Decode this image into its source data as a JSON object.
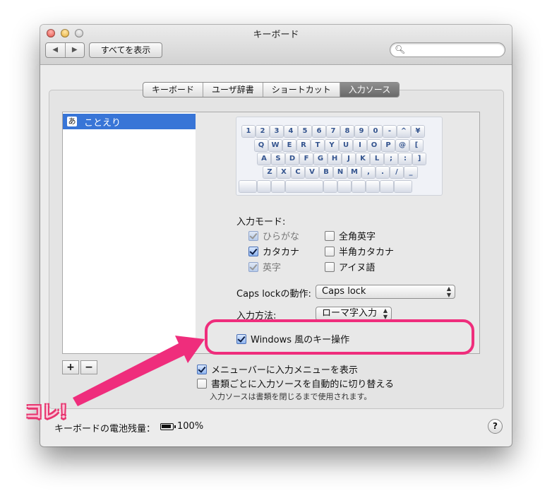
{
  "window": {
    "title": "キーボード",
    "nav_back": "◀",
    "nav_forward": "▶",
    "show_all": "すべてを表示",
    "search_placeholder": ""
  },
  "tabs": [
    {
      "label": "キーボード",
      "active": false
    },
    {
      "label": "ユーザ辞書",
      "active": false
    },
    {
      "label": "ショートカット",
      "active": false
    },
    {
      "label": "入力ソース",
      "active": true
    }
  ],
  "sources": [
    {
      "glyph": "あ",
      "label": "ことえり",
      "selected": true
    }
  ],
  "keyboard": {
    "rows": [
      [
        "1",
        "2",
        "3",
        "4",
        "5",
        "6",
        "7",
        "8",
        "9",
        "0",
        "-",
        "^",
        "¥"
      ],
      [
        "Q",
        "W",
        "E",
        "R",
        "T",
        "Y",
        "U",
        "I",
        "O",
        "P",
        "@",
        "["
      ],
      [
        "A",
        "S",
        "D",
        "F",
        "G",
        "H",
        "J",
        "K",
        "L",
        ";",
        ":",
        "]"
      ],
      [
        "Z",
        "X",
        "C",
        "V",
        "B",
        "N",
        "M",
        ",",
        ".",
        "/",
        "_"
      ]
    ]
  },
  "input_mode": {
    "label": "入力モード:",
    "options": [
      {
        "label": "ひらがな",
        "checked": true,
        "enabled": false
      },
      {
        "label": "全角英字",
        "checked": false,
        "enabled": true
      },
      {
        "label": "カタカナ",
        "checked": true,
        "enabled": true
      },
      {
        "label": "半角カタカナ",
        "checked": false,
        "enabled": true
      },
      {
        "label": "英字",
        "checked": true,
        "enabled": false
      },
      {
        "label": "アイヌ語",
        "checked": false,
        "enabled": true
      }
    ]
  },
  "caps_lock": {
    "label": "Caps lockの動作:",
    "value": "Caps lock"
  },
  "input_method": {
    "label": "入力方法:",
    "value": "ローマ字入力"
  },
  "windows_keys": {
    "label": "Windows 風のキー操作",
    "checked": true
  },
  "add_button": "+",
  "remove_button": "−",
  "show_menu": {
    "label": "メニューバーに入力メニューを表示",
    "checked": true
  },
  "auto_switch": {
    "label": "書類ごとに入力ソースを自動的に切り替える",
    "checked": false
  },
  "auto_switch_note": "入力ソースは書類を閉じるまで使用されます。",
  "battery": {
    "label": "キーボードの電池残量：",
    "percent": "100%"
  },
  "help": "?",
  "annotation": {
    "text": "コレ！",
    "color": "#ef2d7c"
  }
}
